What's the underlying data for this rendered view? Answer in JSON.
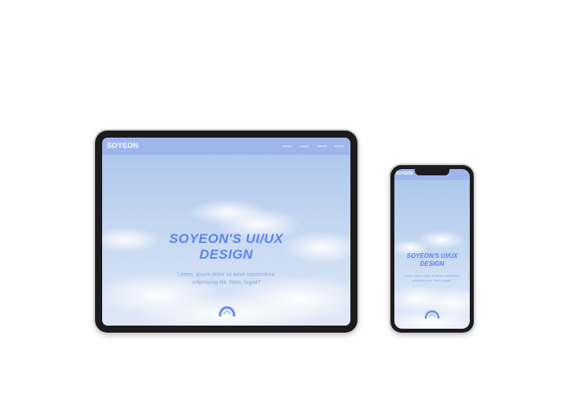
{
  "tablet": {
    "logo": "SOYEON",
    "menu": [
      "menu1",
      "menu2",
      "menu3",
      "menu4"
    ],
    "hero_title_line1": "SOYEON'S UI/UX",
    "hero_title_line2": "DESIGN",
    "hero_sub_line1": "Lorem, ipsum dolor sit amet consectetur",
    "hero_sub_line2": "adipisicing elit. Rem, fugiat?"
  },
  "phone": {
    "logo": "SOYEON",
    "hero_title_line1": "SOYEON'S UI/UX",
    "hero_title_line2": "DESIGN",
    "hero_sub_line1": "Lorem, ipsum dolor sit amet consectetur",
    "hero_sub_line2": "adipisicing elit. Rem, fugiat?"
  },
  "colors": {
    "accent": "#5a84ec",
    "subtext": "#8aa7f0",
    "device_frame": "#1c1c1e",
    "background": "#ffffff"
  },
  "icons": {
    "hero_icon": "cloud-arrow-icon"
  }
}
